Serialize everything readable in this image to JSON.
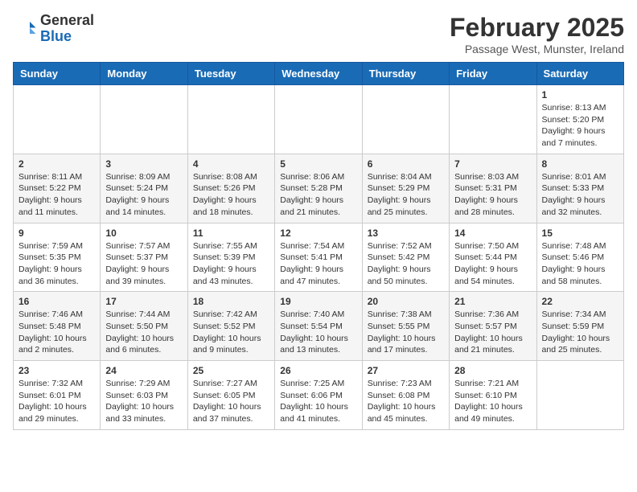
{
  "logo": {
    "general": "General",
    "blue": "Blue"
  },
  "header": {
    "month_title": "February 2025",
    "subtitle": "Passage West, Munster, Ireland"
  },
  "weekdays": [
    "Sunday",
    "Monday",
    "Tuesday",
    "Wednesday",
    "Thursday",
    "Friday",
    "Saturday"
  ],
  "weeks": [
    [
      {
        "day": "",
        "info": ""
      },
      {
        "day": "",
        "info": ""
      },
      {
        "day": "",
        "info": ""
      },
      {
        "day": "",
        "info": ""
      },
      {
        "day": "",
        "info": ""
      },
      {
        "day": "",
        "info": ""
      },
      {
        "day": "1",
        "info": "Sunrise: 8:13 AM\nSunset: 5:20 PM\nDaylight: 9 hours and 7 minutes."
      }
    ],
    [
      {
        "day": "2",
        "info": "Sunrise: 8:11 AM\nSunset: 5:22 PM\nDaylight: 9 hours and 11 minutes."
      },
      {
        "day": "3",
        "info": "Sunrise: 8:09 AM\nSunset: 5:24 PM\nDaylight: 9 hours and 14 minutes."
      },
      {
        "day": "4",
        "info": "Sunrise: 8:08 AM\nSunset: 5:26 PM\nDaylight: 9 hours and 18 minutes."
      },
      {
        "day": "5",
        "info": "Sunrise: 8:06 AM\nSunset: 5:28 PM\nDaylight: 9 hours and 21 minutes."
      },
      {
        "day": "6",
        "info": "Sunrise: 8:04 AM\nSunset: 5:29 PM\nDaylight: 9 hours and 25 minutes."
      },
      {
        "day": "7",
        "info": "Sunrise: 8:03 AM\nSunset: 5:31 PM\nDaylight: 9 hours and 28 minutes."
      },
      {
        "day": "8",
        "info": "Sunrise: 8:01 AM\nSunset: 5:33 PM\nDaylight: 9 hours and 32 minutes."
      }
    ],
    [
      {
        "day": "9",
        "info": "Sunrise: 7:59 AM\nSunset: 5:35 PM\nDaylight: 9 hours and 36 minutes."
      },
      {
        "day": "10",
        "info": "Sunrise: 7:57 AM\nSunset: 5:37 PM\nDaylight: 9 hours and 39 minutes."
      },
      {
        "day": "11",
        "info": "Sunrise: 7:55 AM\nSunset: 5:39 PM\nDaylight: 9 hours and 43 minutes."
      },
      {
        "day": "12",
        "info": "Sunrise: 7:54 AM\nSunset: 5:41 PM\nDaylight: 9 hours and 47 minutes."
      },
      {
        "day": "13",
        "info": "Sunrise: 7:52 AM\nSunset: 5:42 PM\nDaylight: 9 hours and 50 minutes."
      },
      {
        "day": "14",
        "info": "Sunrise: 7:50 AM\nSunset: 5:44 PM\nDaylight: 9 hours and 54 minutes."
      },
      {
        "day": "15",
        "info": "Sunrise: 7:48 AM\nSunset: 5:46 PM\nDaylight: 9 hours and 58 minutes."
      }
    ],
    [
      {
        "day": "16",
        "info": "Sunrise: 7:46 AM\nSunset: 5:48 PM\nDaylight: 10 hours and 2 minutes."
      },
      {
        "day": "17",
        "info": "Sunrise: 7:44 AM\nSunset: 5:50 PM\nDaylight: 10 hours and 6 minutes."
      },
      {
        "day": "18",
        "info": "Sunrise: 7:42 AM\nSunset: 5:52 PM\nDaylight: 10 hours and 9 minutes."
      },
      {
        "day": "19",
        "info": "Sunrise: 7:40 AM\nSunset: 5:54 PM\nDaylight: 10 hours and 13 minutes."
      },
      {
        "day": "20",
        "info": "Sunrise: 7:38 AM\nSunset: 5:55 PM\nDaylight: 10 hours and 17 minutes."
      },
      {
        "day": "21",
        "info": "Sunrise: 7:36 AM\nSunset: 5:57 PM\nDaylight: 10 hours and 21 minutes."
      },
      {
        "day": "22",
        "info": "Sunrise: 7:34 AM\nSunset: 5:59 PM\nDaylight: 10 hours and 25 minutes."
      }
    ],
    [
      {
        "day": "23",
        "info": "Sunrise: 7:32 AM\nSunset: 6:01 PM\nDaylight: 10 hours and 29 minutes."
      },
      {
        "day": "24",
        "info": "Sunrise: 7:29 AM\nSunset: 6:03 PM\nDaylight: 10 hours and 33 minutes."
      },
      {
        "day": "25",
        "info": "Sunrise: 7:27 AM\nSunset: 6:05 PM\nDaylight: 10 hours and 37 minutes."
      },
      {
        "day": "26",
        "info": "Sunrise: 7:25 AM\nSunset: 6:06 PM\nDaylight: 10 hours and 41 minutes."
      },
      {
        "day": "27",
        "info": "Sunrise: 7:23 AM\nSunset: 6:08 PM\nDaylight: 10 hours and 45 minutes."
      },
      {
        "day": "28",
        "info": "Sunrise: 7:21 AM\nSunset: 6:10 PM\nDaylight: 10 hours and 49 minutes."
      },
      {
        "day": "",
        "info": ""
      }
    ]
  ]
}
